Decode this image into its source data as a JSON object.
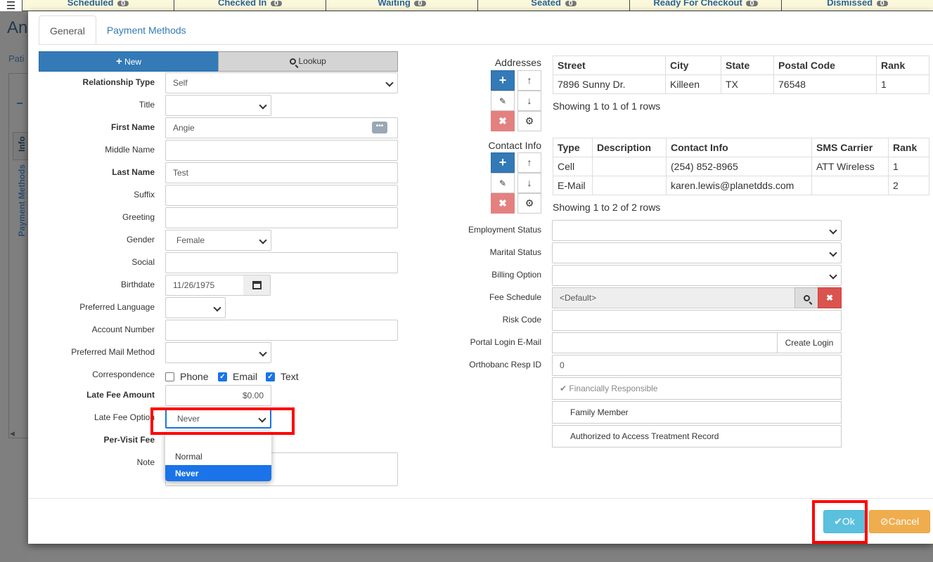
{
  "background": {
    "menu_icon": "hamburger-icon",
    "statuses": [
      {
        "label": "Scheduled",
        "count": "0"
      },
      {
        "label": "Checked In",
        "count": "0"
      },
      {
        "label": "Waiting",
        "count": "0"
      },
      {
        "label": "Seated",
        "count": "0"
      },
      {
        "label": "Ready For Checkout",
        "count": "0"
      },
      {
        "label": "Dismissed",
        "count": "0"
      }
    ],
    "title_partial": "An",
    "patient_partial": "Pati",
    "side_tab_info": "Info",
    "side_tab_payment": "Payment Methods"
  },
  "tabs": [
    {
      "label": "General",
      "active": true
    },
    {
      "label": "Payment Methods",
      "active": false
    }
  ],
  "actions": {
    "new_label": "New",
    "lookup_label": "Lookup"
  },
  "form": {
    "relationship_type": {
      "label": "Relationship Type",
      "value": "Self"
    },
    "title": {
      "label": "Title",
      "value": ""
    },
    "first_name": {
      "label": "First Name",
      "value": "Angie"
    },
    "middle_name": {
      "label": "Middle Name",
      "value": ""
    },
    "last_name": {
      "label": "Last Name",
      "value": "Test"
    },
    "suffix": {
      "label": "Suffix",
      "value": ""
    },
    "greeting": {
      "label": "Greeting",
      "value": ""
    },
    "gender": {
      "label": "Gender",
      "value": "Female"
    },
    "social": {
      "label": "Social",
      "value": ""
    },
    "birthdate": {
      "label": "Birthdate",
      "value": "11/26/1975"
    },
    "preferred_language": {
      "label": "Preferred Language",
      "value": ""
    },
    "account_number": {
      "label": "Account Number",
      "value": ""
    },
    "preferred_mail_method": {
      "label": "Preferred Mail Method",
      "value": ""
    },
    "correspondence": {
      "label": "Correspondence",
      "options": [
        {
          "label": "Phone",
          "checked": false
        },
        {
          "label": "Email",
          "checked": true
        },
        {
          "label": "Text",
          "checked": true
        }
      ]
    },
    "late_fee_amount": {
      "label": "Late Fee Amount",
      "value": "$0.00"
    },
    "late_fee_option": {
      "label": "Late Fee Option",
      "value": "Never",
      "options": [
        "",
        "Normal",
        "Never"
      ]
    },
    "per_visit_fee": {
      "label": "Per-Visit Fee"
    },
    "note": {
      "label": "Note",
      "value": ""
    }
  },
  "addresses": {
    "label": "Addresses",
    "columns": [
      "Street",
      "City",
      "State",
      "Postal Code",
      "Rank"
    ],
    "rows": [
      [
        "7896 Sunny Dr.",
        "Killeen",
        "TX",
        "76548",
        "1"
      ]
    ],
    "showing": "Showing 1 to 1 of 1 rows"
  },
  "contact_info": {
    "label": "Contact Info",
    "columns": [
      "Type",
      "Description",
      "Contact Info",
      "SMS Carrier",
      "Rank"
    ],
    "rows": [
      [
        "Cell",
        "",
        "(254) 852-8965",
        "ATT Wireless",
        "1"
      ],
      [
        "E-Mail",
        "",
        "karen.lewis@planetdds.com",
        "",
        "2"
      ]
    ],
    "showing": "Showing 1 to 2 of 2 rows"
  },
  "right_form": {
    "employment_status": {
      "label": "Employment Status",
      "value": ""
    },
    "marital_status": {
      "label": "Marital Status",
      "value": ""
    },
    "billing_option": {
      "label": "Billing Option",
      "value": ""
    },
    "fee_schedule": {
      "label": "Fee Schedule",
      "value": "<Default>"
    },
    "risk_code": {
      "label": "Risk Code",
      "value": ""
    },
    "portal_login_email": {
      "label": "Portal Login E-Mail",
      "value": "",
      "button": "Create Login"
    },
    "orthobanc_resp_id": {
      "label": "Orthobanc Resp ID",
      "value": "0"
    },
    "financially_responsible": "Financially Responsible",
    "family_member": "Family Member",
    "authorized_access": "Authorized to Access Treatment Record"
  },
  "footer": {
    "ok_label": "Ok",
    "cancel_label": "Cancel"
  },
  "colors": {
    "primary": "#337ab7",
    "info": "#5bc0de",
    "warning": "#f0ad4e",
    "danger": "#d9534f",
    "highlight": "#ff0000"
  }
}
